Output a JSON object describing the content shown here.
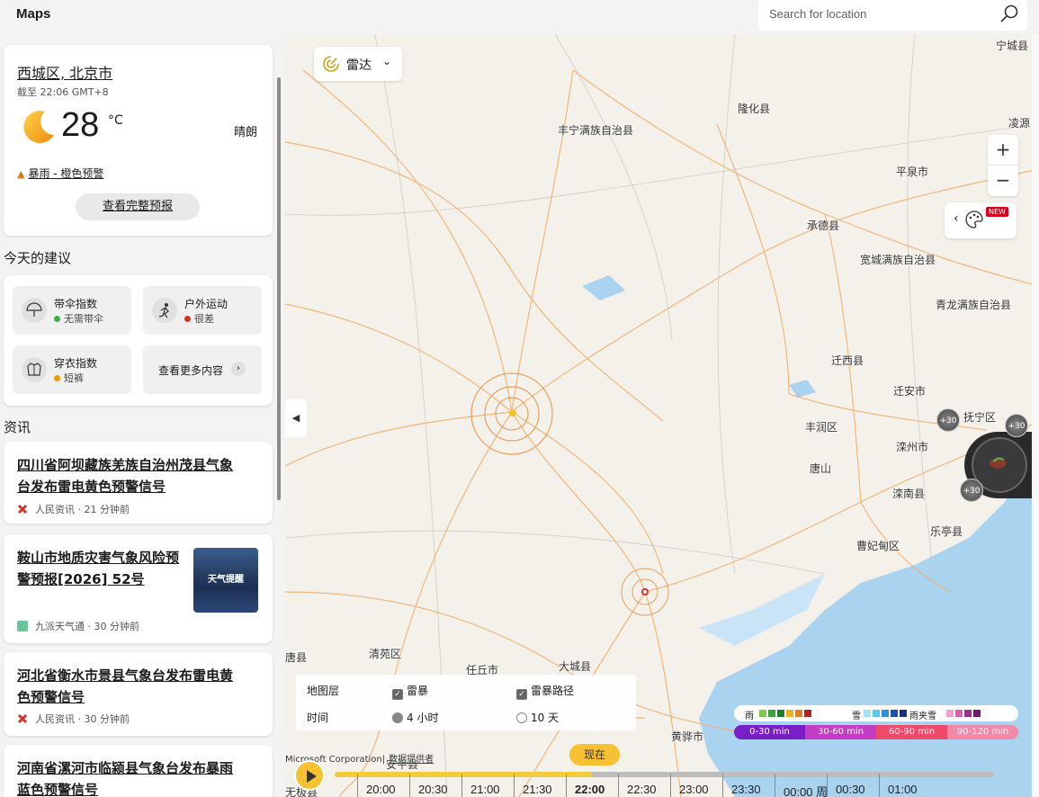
{
  "app": {
    "title": "Maps"
  },
  "search": {
    "placeholder": "Search for location"
  },
  "weather": {
    "location": "西城区, 北京市",
    "updated": "截至 22:06 GMT+8",
    "temperature": "28",
    "unit": "°C",
    "condition": "晴朗",
    "alert": "暴雨 - 橙色预警",
    "full_forecast": "查看完整预报"
  },
  "suggestions": {
    "title": "今天的建议",
    "items": [
      {
        "label": "带伞指数",
        "value": "无需带伞",
        "status_color": "#3cb043",
        "icon": "umbrella-icon"
      },
      {
        "label": "户外运动",
        "value": "很差",
        "status_color": "#d93025",
        "icon": "running-icon"
      },
      {
        "label": "穿衣指数",
        "value": "短裤",
        "status_color": "#f29900",
        "icon": "shirt-icon"
      }
    ],
    "more": "查看更多内容"
  },
  "news": {
    "title": "资讯",
    "items": [
      {
        "headline": "四川省阿坝藏族羌族自治州茂县气象台发布雷电黄色预警信号",
        "source": "人民资讯",
        "time": "21 分钟前"
      },
      {
        "headline": "鞍山市地质灾害气象风险预警预报[2026] 52号",
        "source": "九派天气通",
        "time": "30 分钟前",
        "thumb": "天气提醒"
      },
      {
        "headline": "河北省衡水市景县气象台发布雷电黄色预警信号",
        "source": "人民资讯",
        "time": "30 分钟前"
      },
      {
        "headline": "河南省漯河市临颍县气象台发布暴雨蓝色预警信号",
        "source": "",
        "time": ""
      }
    ]
  },
  "map": {
    "layer_button": "雷达",
    "new_badge": "NEW",
    "labels": [
      "宁城县",
      "隆化县",
      "丰宁满族自治县",
      "凌源",
      "平泉市",
      "承德县",
      "宽城满族自治县",
      "青龙满族自治县",
      "迁西县",
      "迁安市",
      "抚宁区",
      "丰润区",
      "滦州市",
      "唐山",
      "滦南县",
      "乐亭县",
      "曹妃甸区",
      "唐县",
      "清苑区",
      "任丘市",
      "大城县",
      "黄骅市",
      "安平县",
      "无极县"
    ],
    "storm_chips": [
      "+30",
      "+30",
      "+30"
    ]
  },
  "options": {
    "layer_label": "地图层",
    "storm": "雷暴",
    "storm_path": "雷暴路径",
    "time_label": "时间",
    "four_hours": "4 小时",
    "ten_days": "10 天"
  },
  "legend": {
    "rain": "雨",
    "snow": "雪",
    "sleet": "雨夹雪",
    "rain_colors": [
      "#7ec850",
      "#3aa23a",
      "#1e7a2e",
      "#e6b422",
      "#d9822b",
      "#b22222"
    ],
    "snow_colors": [
      "#a6e0f0",
      "#5ec8e8",
      "#2f8fd8",
      "#1f4fb0",
      "#1a2f80"
    ],
    "sleet_colors": [
      "#f0a0d0",
      "#d060b0",
      "#a03090",
      "#701870"
    ],
    "segments": [
      {
        "label": "0-30 min",
        "color": "#7a1ec8"
      },
      {
        "label": "30-60 min",
        "color": "#c43cc4"
      },
      {
        "label": "60-90 min",
        "color": "#f04a6a"
      },
      {
        "label": "90-120 min",
        "color": "#f08aa8"
      }
    ]
  },
  "attribution": {
    "text": "Microsoft Corporation|",
    "link": "数据提供者"
  },
  "timeline": {
    "now": "现在",
    "progress": 0.39,
    "ticks": [
      "20:00",
      "20:30",
      "21:00",
      "21:30",
      "22:00",
      "22:30",
      "23:00",
      "23:30",
      "00:00 周",
      "00:30",
      "01:00"
    ],
    "current_index": 4
  }
}
